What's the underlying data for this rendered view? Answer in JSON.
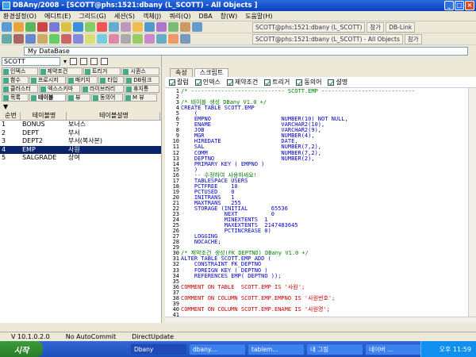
{
  "window": {
    "title": "DBAny/2008 - [SCOTT@phs:1521:dbany (L_SCOTT) - All Objects ]"
  },
  "menu": [
    "환경설정(O)",
    "에디트(E)",
    "그리드(G)",
    "세션(S)",
    "객체(J)",
    "쿼리(Q)",
    "DBA",
    "창(W)",
    "도움말(H)"
  ],
  "doc_tabs": [
    "SCOTT@phs:1521:dbany (L_SCOTT)",
    "참가",
    "DB-Link",
    "SCOTT@phs:1521:dbany (L_SCOTT) - All Objects",
    "참가"
  ],
  "db_label": "My DataBase",
  "schema_select": "SCOTT",
  "object_tabs": [
    [
      "인덱스",
      "제약조건",
      "트리거",
      "시퀀스"
    ],
    [
      "함수",
      "프로시저",
      "패키지",
      "타입",
      "DB링크"
    ],
    [
      "클러스터",
      "엑스스키마",
      "라이브러리",
      "휴지통"
    ],
    [
      "목록",
      "테이블",
      "뷰",
      "동의어",
      "M 뷰"
    ]
  ],
  "table_list": {
    "headers": [
      "순번",
      "테이블명",
      "테이블설명"
    ],
    "rows": [
      [
        "1",
        "BONUS",
        "보너스"
      ],
      [
        "2",
        "DEPT",
        "부서"
      ],
      [
        "3",
        "DEPT2",
        "부서(복사본)"
      ],
      [
        "4",
        "EMP",
        "사원"
      ],
      [
        "5",
        "SALGRADE",
        "상여"
      ]
    ],
    "selected_index": 3
  },
  "right_tabs": [
    "속성",
    "스크립트"
  ],
  "checks": [
    "칼럼",
    "인덱스",
    "제약조건",
    "트리거",
    "동의어",
    "설명"
  ],
  "script_lines": [
    [
      "1",
      "/* ---------------------------- SCOTT.EMP ----------------------------",
      "cm"
    ],
    [
      "2",
      "",
      ""
    ],
    [
      "3",
      "/* 테이블 생성 DBany V1.0 +/",
      "cm"
    ],
    [
      "4",
      "CREATE TABLE SCOTT.EMP",
      ""
    ],
    [
      "5",
      "    (",
      ""
    ],
    [
      "6",
      "    EMPNO                     NUMBER(10) NOT NULL,",
      ""
    ],
    [
      "7",
      "    ENAME                     VARCHAR2(10),",
      ""
    ],
    [
      "8",
      "    JOB                       VARCHAR2(9),",
      ""
    ],
    [
      "9",
      "    MGR                       NUMBER(4),",
      ""
    ],
    [
      "10",
      "    HIREDATE                  DATE,",
      ""
    ],
    [
      "11",
      "    SAL                       NUMBER(7,2),",
      ""
    ],
    [
      "12",
      "    COMM                      NUMBER(7,2),",
      ""
    ],
    [
      "13",
      "    DEPTNO                    NUMBER(2),",
      ""
    ],
    [
      "14",
      "    PRIMARY KEY ( EMPNO )",
      ""
    ],
    [
      "15",
      "    )",
      ""
    ],
    [
      "16",
      "    -- 수정하여 사용하세요!",
      "cm"
    ],
    [
      "17",
      "    TABLESPACE USERS",
      ""
    ],
    [
      "18",
      "    PCTFREE    10",
      ""
    ],
    [
      "19",
      "    PCTUSED    0",
      ""
    ],
    [
      "20",
      "    INITRANS   1",
      ""
    ],
    [
      "21",
      "    MAXTRANS   255",
      ""
    ],
    [
      "22",
      "    STORAGE (INITIAL       65536",
      ""
    ],
    [
      "23",
      "             NEXT          0",
      ""
    ],
    [
      "24",
      "             MINEXTENTS  1",
      ""
    ],
    [
      "25",
      "             MAXEXTENTS  2147483645",
      ""
    ],
    [
      "26",
      "             PCTINCREASE 0)",
      ""
    ],
    [
      "27",
      "    LOGGING",
      ""
    ],
    [
      "28",
      "    NOCACHE;",
      ""
    ],
    [
      "29",
      "",
      ""
    ],
    [
      "30",
      "/* 제약조건 생성(FK_DEPTNO) DBany V1.0 +/",
      "cm"
    ],
    [
      "31",
      "ALTER TABLE SCOTT.EMP ADD (",
      ""
    ],
    [
      "32",
      "    CONSTRAINT FK_DEPTNO",
      ""
    ],
    [
      "33",
      "    FOREIGN KEY ( DEPTNO )",
      ""
    ],
    [
      "34",
      "    REFERENCES EMP( DEPTNO ));",
      ""
    ],
    [
      "35",
      "",
      ""
    ],
    [
      "36",
      "COMMENT ON TABLE  SCOTT.EMP IS '사원';",
      "st"
    ],
    [
      "37",
      "",
      ""
    ],
    [
      "38",
      "COMMENT ON COLUMN SCOTT.EMP.EMPNO IS '사원번호';",
      "st"
    ],
    [
      "39",
      "",
      ""
    ],
    [
      "40",
      "COMMENT ON COLUMN SCOTT.EMP.ENAME IS '사원명';",
      "st"
    ],
    [
      "41",
      "",
      ""
    ]
  ],
  "status": [
    "V 10.1.0.2.0",
    "No AutoCommit",
    "DirectUpdate"
  ],
  "taskbar": {
    "start": "시작",
    "tasks": [
      "Dbany",
      "dbany....",
      "tablem...",
      "내 그림",
      "네이버 ..."
    ],
    "clock": "오후 11:59"
  }
}
